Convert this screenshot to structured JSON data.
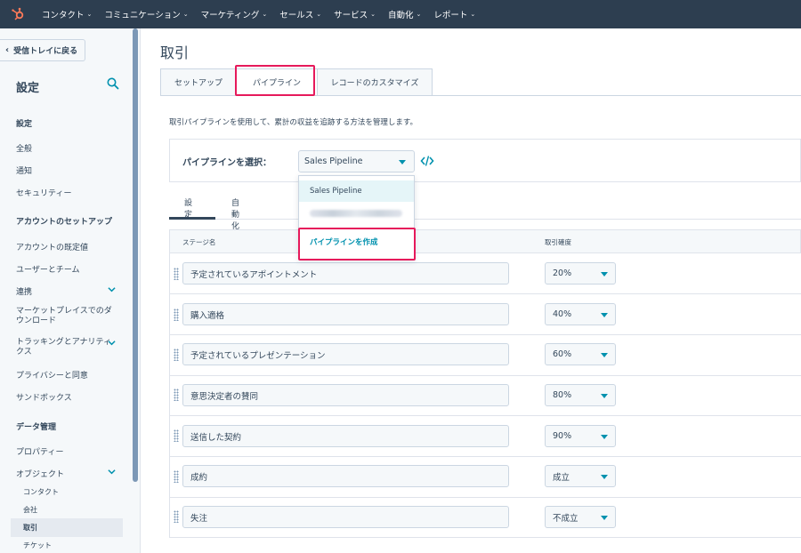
{
  "topnav": {
    "items": [
      "コンタクト",
      "コミュニケーション",
      "マーケティング",
      "セールス",
      "サービス",
      "自動化",
      "レポート"
    ]
  },
  "sidebar": {
    "back_label": "受信トレイに戻る",
    "title": "設定",
    "sections": {
      "settings_head": "設定",
      "general": "全般",
      "notifications": "通知",
      "security": "セキュリティー",
      "account_head": "アカウントのセットアップ",
      "defaults": "アカウントの既定値",
      "users": "ユーザーとチーム",
      "integrations": "連携",
      "marketplace_1": "マーケットプレイスでのダ",
      "marketplace_2": "ウンロード",
      "tracking_1": "トラッキングとアナリティ",
      "tracking_2": "クス",
      "privacy": "プライバシーと同意",
      "sandbox": "サンドボックス",
      "data_head": "データ管理",
      "properties": "プロパティー",
      "objects": "オブジェクト",
      "contacts": "コンタクト",
      "companies": "会社",
      "deals": "取引",
      "tickets": "チケット"
    }
  },
  "main": {
    "title": "取引",
    "tabs": [
      "セットアップ",
      "パイプライン",
      "レコードのカスタマイズ"
    ],
    "description": "取引パイプラインを使用して、累計の収益を追跡する方法を管理します。",
    "pipeline_label": "パイプラインを選択：",
    "pipeline_selected": "Sales Pipeline",
    "menu": {
      "option_1": "Sales Pipeline",
      "create": "パイプラインを作成"
    },
    "subtabs": [
      "設定",
      "自動化"
    ],
    "table": {
      "col_stage": "ステージ名",
      "col_prob": "取引確度",
      "rows": [
        {
          "stage": "予定されているアポイントメント",
          "prob": "20%"
        },
        {
          "stage": "購入適格",
          "prob": "40%"
        },
        {
          "stage": "予定されているプレゼンテーション",
          "prob": "60%"
        },
        {
          "stage": "意思決定者の賛同",
          "prob": "80%"
        },
        {
          "stage": "送信した契約",
          "prob": "90%"
        },
        {
          "stage": "成約",
          "prob": "成立"
        },
        {
          "stage": "失注",
          "prob": "不成立"
        }
      ]
    }
  },
  "colors": {
    "nav_bg": "#2d3e50",
    "accent": "#0091ae",
    "highlight": "#e6195b",
    "logo": "#ff7a59"
  }
}
